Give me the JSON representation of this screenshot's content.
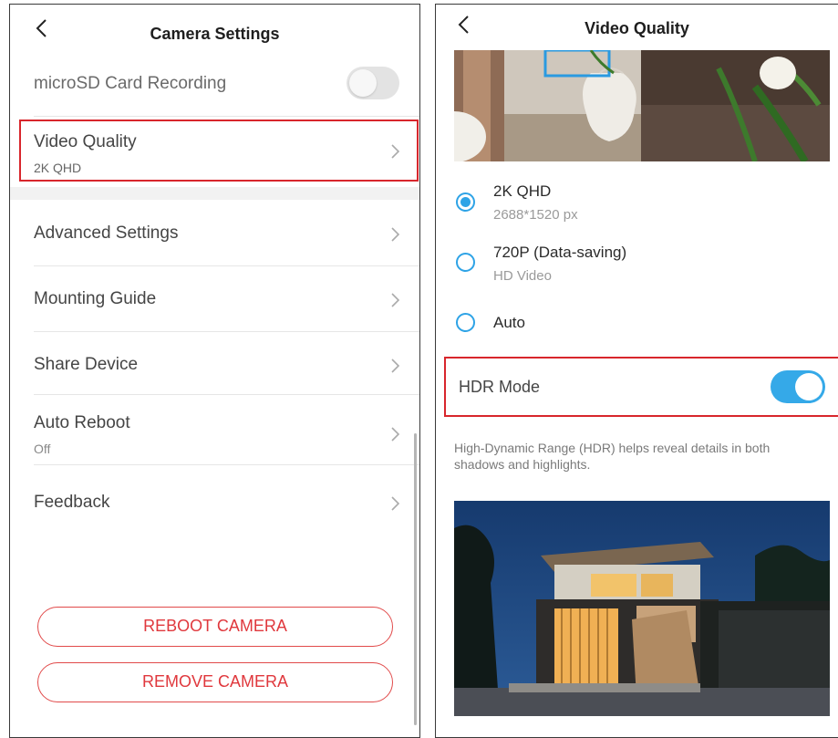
{
  "camera_settings": {
    "title": "Camera Settings",
    "microsd": {
      "label": "microSD Card Recording",
      "enabled": false
    },
    "video_quality": {
      "label": "Video Quality",
      "value": "2K QHD"
    },
    "advanced_settings": {
      "label": "Advanced Settings"
    },
    "mounting_guide": {
      "label": "Mounting Guide"
    },
    "share_device": {
      "label": "Share Device"
    },
    "auto_reboot": {
      "label": "Auto Reboot",
      "value": "Off"
    },
    "feedback": {
      "label": "Feedback"
    },
    "reboot_button": "REBOOT CAMERA",
    "remove_button": "REMOVE CAMERA"
  },
  "video_quality_page": {
    "title": "Video Quality",
    "options": [
      {
        "title": "2K QHD",
        "subtitle": "2688*1520 px",
        "selected": true
      },
      {
        "title": "720P (Data-saving)",
        "subtitle": "HD Video",
        "selected": false
      },
      {
        "title": "Auto",
        "subtitle": "",
        "selected": false
      }
    ],
    "hdr": {
      "label": "HDR Mode",
      "enabled": true
    },
    "hdr_description": "High-Dynamic Range (HDR) helps reveal details in both shadows and highlights."
  },
  "colors": {
    "highlight_red": "#d8262c",
    "button_red": "#e0383d",
    "toggle_blue": "#35a9e8"
  },
  "icons": [
    "back-arrow-icon",
    "chevron-right-icon",
    "radio-button-icon",
    "toggle-switch-icon"
  ]
}
